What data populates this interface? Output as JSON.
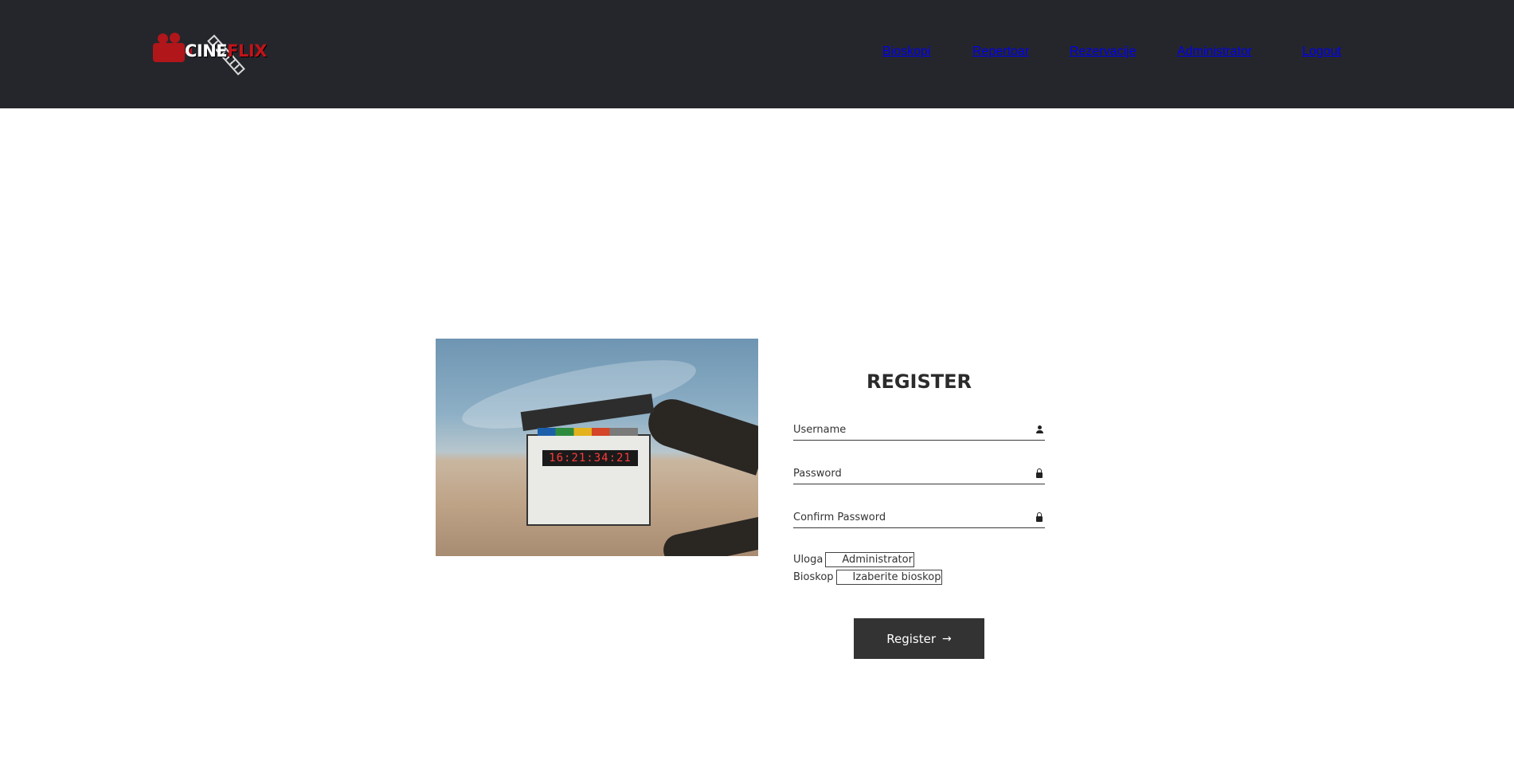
{
  "brand": {
    "logo_text_1": "CINE",
    "logo_text_2": "FLIX",
    "colors": {
      "header_bg": "#25262c",
      "accent": "#c1141a",
      "button_bg": "#333333"
    }
  },
  "nav": {
    "items": [
      {
        "label": "Bioskopi"
      },
      {
        "label": "Repertoar"
      },
      {
        "label": "Rezervacije"
      },
      {
        "label": "Administrator"
      },
      {
        "label": "Logout"
      }
    ]
  },
  "hero": {
    "clapper_digits": "16:21:34:21"
  },
  "form": {
    "title": "REGISTER",
    "username": {
      "placeholder": "Username",
      "icon": "user-icon"
    },
    "password": {
      "placeholder": "Password",
      "icon": "lock-icon"
    },
    "confirm_password": {
      "placeholder": "Confirm Password",
      "icon": "lock-icon"
    },
    "role": {
      "label": "Uloga",
      "value": "Administrator"
    },
    "cinema": {
      "label": "Bioskop",
      "value": "Izaberite bioskop"
    },
    "submit": {
      "label": "Register",
      "icon": "arrow-right-icon"
    }
  }
}
